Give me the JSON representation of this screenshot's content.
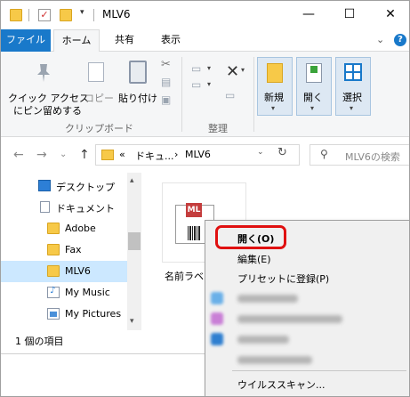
{
  "window": {
    "title": "MLV6",
    "minimize_glyph": "—",
    "maximize_glyph": "☐",
    "close_glyph": "✕",
    "qat_dropdown_glyph": "▾",
    "qat_separator_glyph": "|"
  },
  "ribbon_tabs": {
    "file": "ファイル",
    "home": "ホーム",
    "share": "共有",
    "view": "表示",
    "collapse_glyph": "⌄",
    "help_glyph": "?"
  },
  "ribbon": {
    "quick_access_line1": "クイック アクセス",
    "quick_access_line2": "にピン留めする",
    "copy": "コピー",
    "paste": "貼り付け",
    "clipboard_group": "クリップボード",
    "organize_group": "整理",
    "new": "新規",
    "open": "開く",
    "select": "選択",
    "scissors_glyph": "✂",
    "delete_glyph": "✕",
    "dropdown_glyph": "▾"
  },
  "navigation": {
    "back_glyph": "←",
    "forward_glyph": "→",
    "history_glyph": "⌄",
    "up_glyph": "↑",
    "breadcrumb_prefix": "«",
    "breadcrumb_parent": "ドキュ...",
    "breadcrumb_sep": "›",
    "breadcrumb_current": "MLV6",
    "address_dropdown_glyph": "⌄",
    "refresh_glyph": "↻",
    "search_glyph": "⚲",
    "search_placeholder": "MLV6の検索"
  },
  "tree": {
    "items": [
      {
        "label": "デスクトップ",
        "icon": "desktop-icon"
      },
      {
        "label": "ドキュメント",
        "icon": "documents-icon"
      },
      {
        "label": "Adobe",
        "icon": "folder-icon"
      },
      {
        "label": "Fax",
        "icon": "folder-icon"
      },
      {
        "label": "MLV6",
        "icon": "folder-icon",
        "selected": true
      },
      {
        "label": "My Music",
        "icon": "music-icon"
      },
      {
        "label": "My Pictures",
        "icon": "pictures-icon"
      }
    ],
    "scroll_up_glyph": "▴",
    "scroll_down_glyph": "▾"
  },
  "content": {
    "file_badge": "ML",
    "file_name": "名前ラベル"
  },
  "status": {
    "item_count": "1 個の項目"
  },
  "context_menu": {
    "open": "開く(O)",
    "edit": "編集(E)",
    "preset_register": "プリセットに登録(P)",
    "virus_scan": "ウイルススキャン...",
    "blurred_icon_colors": [
      "#6ab0e8",
      "#c97fd6",
      "#2f7fd0",
      "#c8c8c8"
    ]
  }
}
